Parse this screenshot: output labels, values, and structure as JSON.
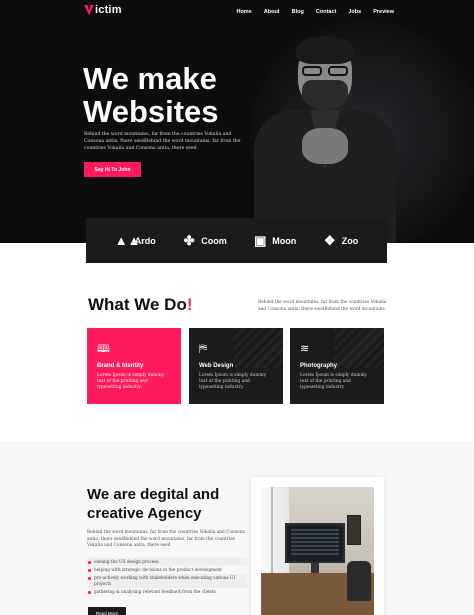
{
  "brand": {
    "name": "ictim",
    "logo_mark": "V"
  },
  "nav": [
    "Home",
    "About",
    "Blog",
    "Contact",
    "Jobs",
    "Preview"
  ],
  "hero": {
    "title_line1": "We make",
    "title_line2": "Websites",
    "text": "Behind the word mountains, far from the countries Vokalia and Consona antia, there seedBehind the word mountains, far from the countries Vokalia and Consona antia, there seed",
    "cta": "Say Hi To John"
  },
  "partners": [
    {
      "icon": "ardo-logo-icon",
      "glyph": "▲▲",
      "label": "Ardo"
    },
    {
      "icon": "coom-logo-icon",
      "glyph": "✤",
      "label": "Coom"
    },
    {
      "icon": "moon-logo-icon",
      "glyph": "▣",
      "label": "Moon"
    },
    {
      "icon": "zoo-logo-icon",
      "glyph": "❖",
      "label": "Zoo"
    }
  ],
  "what_we_do": {
    "title": "What We Do",
    "bang": "!",
    "text": "Behind the word mountains, far from the countries Vokalia and Consona antia, there seedBehind the word mountains",
    "cards": [
      {
        "icon": "book-icon",
        "glyph": "🕮",
        "title": "Brand & Identity",
        "text": "Lorem Ipsum is simply dummy text of the printing and typesetting industry."
      },
      {
        "icon": "map-icon",
        "glyph": "⛿",
        "title": "Web Design",
        "text": "Lorem Ipsum is simply dummy text of the printing and typesetting industry."
      },
      {
        "icon": "layers-icon",
        "glyph": "≋",
        "title": "Photography",
        "text": "Lorem Ipsum is simply dummy text of the printing and typesetting industry."
      }
    ]
  },
  "agency": {
    "title_line1": "We are degital and",
    "title_line2": "creative Agency",
    "text": "Behind the word mountains, far from the countries Vokalia and Consona antia, there seedBehind the word mountains, far from the countries Vokalia and Consona antia, there seed",
    "list": [
      "owning the UX design process",
      "helping with strategic decisions in the product development",
      "pro-actively working with stakeholders when executing various UI projects",
      "gathering & analysing relevant feedback from the clients"
    ],
    "button": "Read More"
  },
  "colors": {
    "accent": "#ff1a5e",
    "dark": "#0d0d0f"
  }
}
